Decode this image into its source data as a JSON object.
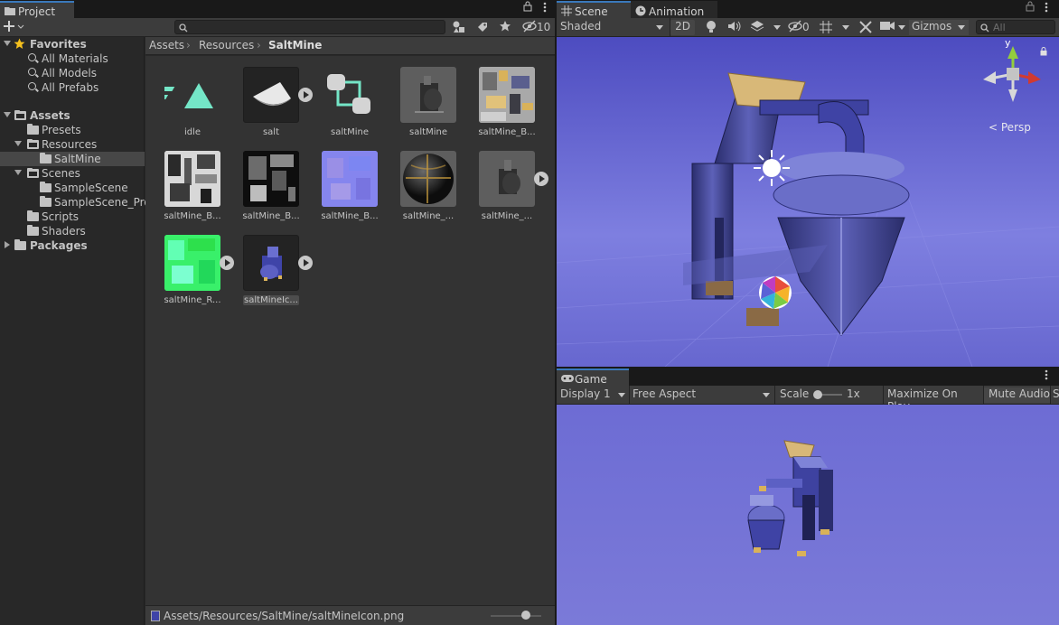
{
  "project": {
    "tab_label": "Project",
    "hidden_count": "10",
    "favorites": {
      "label": "Favorites",
      "items": [
        "All Materials",
        "All Models",
        "All Prefabs"
      ]
    },
    "assets": {
      "label": "Assets",
      "presets": "Presets",
      "resources": "Resources",
      "saltmine": "SaltMine",
      "scenes": "Scenes",
      "scene_items": [
        "SampleScene",
        "SampleScene_Pro"
      ],
      "scripts": "Scripts",
      "shaders": "Shaders"
    },
    "packages": "Packages",
    "breadcrumb": [
      "Assets",
      "Resources",
      "SaltMine"
    ],
    "grid_items": [
      "idle",
      "salt",
      "saltMine",
      "saltMine",
      "saltMine_B...",
      "saltMine_B...",
      "saltMine_B...",
      "saltMine_B...",
      "saltMine_...",
      "saltMine_...",
      "saltMine_R...",
      "saltMineIc..."
    ],
    "selected_path": "Assets/Resources/SaltMine/saltMineIcon.png",
    "thumbnail_zoom": 0.7
  },
  "scene": {
    "tabs": [
      "Scene",
      "Animation"
    ],
    "shading_mode": "Shaded",
    "mode_2d": "2D",
    "hidden_count": "0",
    "gizmos": "Gizmos",
    "search_placeholder": "All",
    "persp_label": "Persp",
    "axis_y": "y"
  },
  "game": {
    "tab_label": "Game",
    "display": "Display 1",
    "aspect": "Free Aspect",
    "scale_label": "Scale",
    "scale_value": "1x",
    "maximize": "Maximize On Play",
    "mute": "Mute Audio",
    "stats": "S"
  },
  "colors": {
    "accent": "#3a79bb",
    "sky": "#7a79d8",
    "selected": "#474747"
  }
}
